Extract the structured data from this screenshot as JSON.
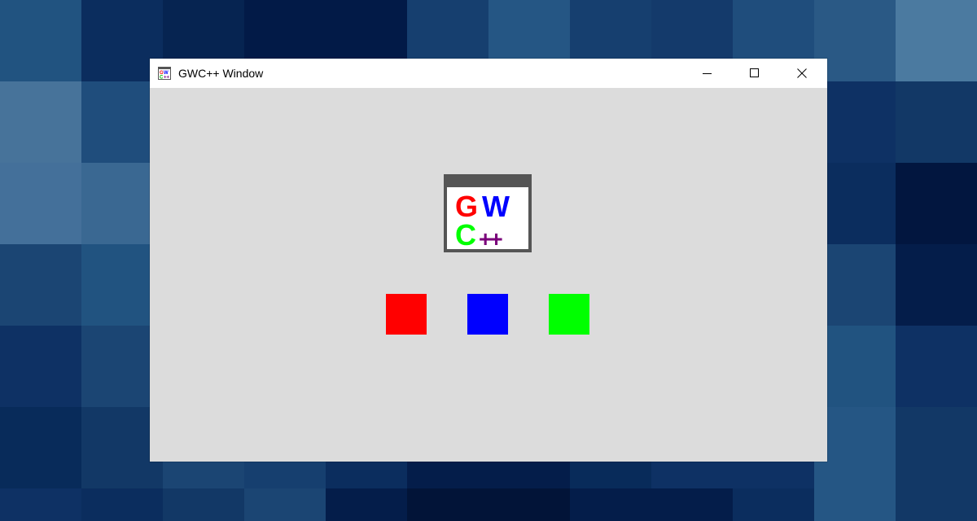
{
  "desktop": {
    "tiles": [
      "#215380",
      "#0b2d5e",
      "#062451",
      "#021a47",
      "#021a47",
      "#163f6f",
      "#255684",
      "#163f6f",
      "#143a6b",
      "#1f4d7c",
      "#2a5985",
      "#4b7aa0",
      "#47739a",
      "#1f4d7c",
      "#0b2d5e",
      "#0e3164",
      "#143a6b",
      "#1b4573",
      "#1b4573",
      "#0e3164",
      "#0e3164",
      "#1f4d7c",
      "#0e3164",
      "#123866",
      "#44709a",
      "#3a6892",
      "#143a6b",
      "#123866",
      "#0b2d5e",
      "#123866",
      "#0e3164",
      "#0e3164",
      "#0b2d5e",
      "#0b2d5e",
      "#0b2d5e",
      "#02163f",
      "#1b4573",
      "#215380",
      "#0e3164",
      "#0e3164",
      "#0b2d5e",
      "#0e3164",
      "#0b2d5e",
      "#0b2d5e",
      "#0e3164",
      "#0b2d5e",
      "#1b4573",
      "#041d4a",
      "#0e3164",
      "#1b4573",
      "#0b2d5e",
      "#0e3164",
      "#0e3164",
      "#0b2d5e",
      "#0b2d5e",
      "#0e3164",
      "#0e3164",
      "#0b2d5e",
      "#215380",
      "#0e3164",
      "#082b5a",
      "#123866",
      "#1b4573",
      "#163f6f",
      "#0b2d5e",
      "#041d4a",
      "#041d4a",
      "#082b5a",
      "#0e3164",
      "#0e3164",
      "#255684",
      "#123866",
      "#0e3164",
      "#0b2d5e",
      "#123866",
      "#1b4573",
      "#041d4a",
      "#021438",
      "#021438",
      "#041d4a",
      "#041d4a",
      "#0b2d5e",
      "#255684",
      "#123866"
    ]
  },
  "window": {
    "title": "GWC++ Window",
    "icon": "gwc-app-icon",
    "controls": {
      "minimize_icon": "minimize-icon",
      "maximize_icon": "maximize-icon",
      "close_icon": "close-icon"
    },
    "background": "#dcdcdc",
    "logo": {
      "line1_left": "G",
      "line1_right": "W",
      "line2_left": "C",
      "line2_right": "++",
      "colors": {
        "g": "#ff0000",
        "w": "#0000ff",
        "c": "#00ff00",
        "plus": "#7a007a",
        "frame": "#555555"
      }
    },
    "squares": [
      {
        "name": "red",
        "color": "#ff0000"
      },
      {
        "name": "blue",
        "color": "#0000ff"
      },
      {
        "name": "green",
        "color": "#00ff00"
      }
    ]
  }
}
